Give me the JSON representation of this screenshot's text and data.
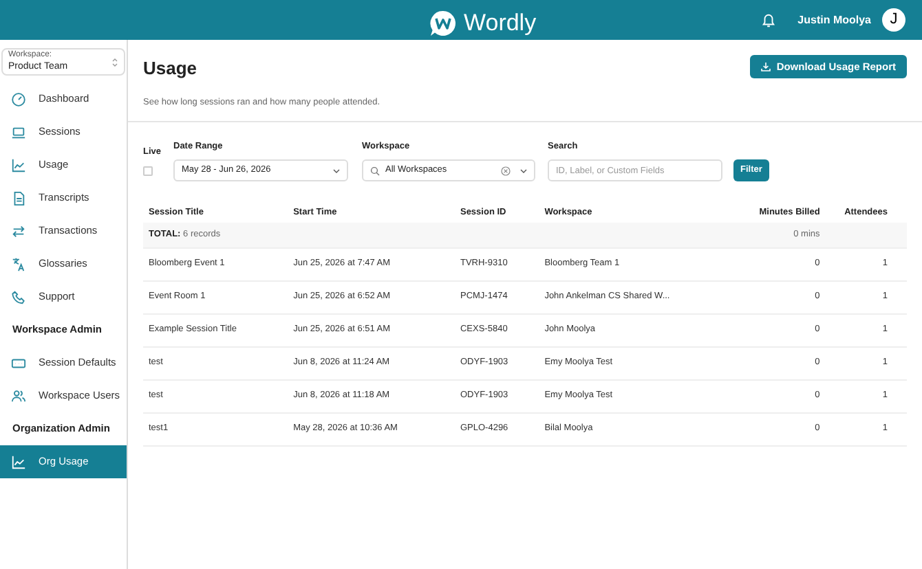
{
  "header": {
    "logo_text": "Wordly",
    "user_name": "Justin Moolya",
    "avatar_initial": "J"
  },
  "sidebar": {
    "workspace_label": "Workspace:",
    "workspace_value": "Product Team",
    "items": [
      {
        "kind": "nav",
        "label": "Dashboard",
        "selected": false
      },
      {
        "kind": "nav",
        "label": "Sessions",
        "selected": false
      },
      {
        "kind": "nav",
        "label": "Usage",
        "selected": false
      },
      {
        "kind": "nav",
        "label": "Transcripts",
        "selected": false
      },
      {
        "kind": "nav",
        "label": "Transactions",
        "selected": false
      },
      {
        "kind": "nav",
        "label": "Glossaries",
        "selected": false
      },
      {
        "kind": "nav",
        "label": "Support",
        "selected": false
      },
      {
        "kind": "heading",
        "label": "Workspace Admin"
      },
      {
        "kind": "nav",
        "label": "Session Defaults",
        "selected": false
      },
      {
        "kind": "nav",
        "label": "Workspace Users",
        "selected": false
      },
      {
        "kind": "heading",
        "label": "Organization Admin"
      },
      {
        "kind": "nav",
        "label": "Org Usage",
        "selected": true
      }
    ]
  },
  "page": {
    "title": "Usage",
    "subtitle": "See how long sessions ran and how many people attended.",
    "download_button": "Download Usage Report"
  },
  "filters": {
    "live": {
      "label": "Live",
      "checked": false
    },
    "date_range": {
      "label": "Date Range",
      "value": "May 28 - Jun 26, 2026"
    },
    "workspace": {
      "label": "Workspace",
      "value": "All Workspaces"
    },
    "search": {
      "label": "Search",
      "placeholder": "ID, Label, or Custom Fields"
    },
    "filter_button": "Filter"
  },
  "table": {
    "columns": [
      "Session Title",
      "Start Time",
      "Session ID",
      "Workspace",
      "Minutes Billed",
      "Attendees"
    ],
    "total": {
      "label": "TOTAL:",
      "records": "6 records",
      "minutes": "0 mins"
    },
    "rows": [
      [
        "Bloomberg Event 1",
        "Jun 25, 2026 at 7:47 AM",
        "TVRH-9310",
        "Bloomberg Team 1",
        "0",
        "1"
      ],
      [
        "Event Room 1",
        "Jun 25, 2026 at 6:52 AM",
        "PCMJ-1474",
        "John Ankelman CS Shared W...",
        "0",
        "1"
      ],
      [
        "Example Session Title",
        "Jun 25, 2026 at 6:51 AM",
        "CEXS-5840",
        "John Moolya",
        "0",
        "1"
      ],
      [
        "test",
        "Jun 8, 2026 at 11:24 AM",
        "ODYF-1903",
        "Emy Moolya Test",
        "0",
        "1"
      ],
      [
        "test",
        "Jun 8, 2026 at 11:18 AM",
        "ODYF-1903",
        "Emy Moolya Test",
        "0",
        "1"
      ],
      [
        "test1",
        "May 28, 2026 at 10:36 AM",
        "GPLO-4296",
        "Bilal Moolya",
        "0",
        "1"
      ]
    ]
  }
}
